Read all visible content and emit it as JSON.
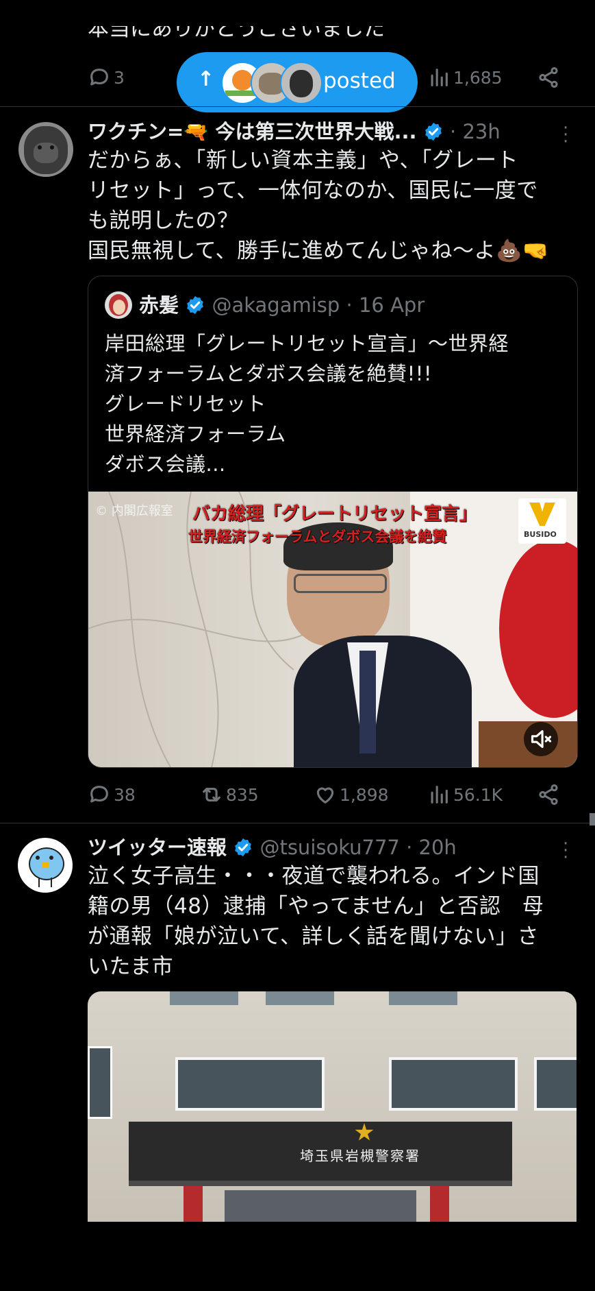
{
  "top_tweet": {
    "text_fragment": "本当にありがとうございました",
    "replies": "3",
    "views": "1,685"
  },
  "new_posts_pill": {
    "label": "posted",
    "accent": "#1d9bf0"
  },
  "tweet1": {
    "name": "ワクチン=🔫 今は第三次世界大戦...",
    "time": "23h",
    "text": "だからぁ、「新しい資本主義」や、「グレート\nリセット」って、一体何なのか、国民に一度で\nも説明したの？\n国民無視して、勝手に進めてんじゃね〜よ💩🤜",
    "quote": {
      "name": "赤髪",
      "handle": "@akagamisp",
      "date": "16 Apr",
      "text": "岸田総理「グレートリセット宣言」〜世界経\n済フォーラムとダボス会議を絶賛!!!\nグレードリセット\n世界経済フォーラム\nダボス会議...",
      "video_overlay_title": "バカ総理「グレートリセット宣言」",
      "video_overlay_sub": "世界経済フォーラムとダボス会議を絶賛",
      "video_credit": "© 内閣広報室",
      "video_logo": "BUSIDO"
    },
    "replies": "38",
    "retweets": "835",
    "likes": "1,898",
    "views": "56.1K"
  },
  "tweet2": {
    "name": "ツイッター速報",
    "handle": "@tsuisoku777",
    "time": "20h",
    "text": "泣く女子高生・・・夜道で襲われる。インド国\n籍の男（48）逮捕「やってません」と否認　母\nが通報「娘が泣いて、詳しく話を聞けない」さ\nいたま市",
    "media_sign": "埼玉県岩槻警察署"
  },
  "colors": {
    "verified": "#1d9bf0",
    "border": "#2f3336",
    "muted": "#71767b"
  }
}
